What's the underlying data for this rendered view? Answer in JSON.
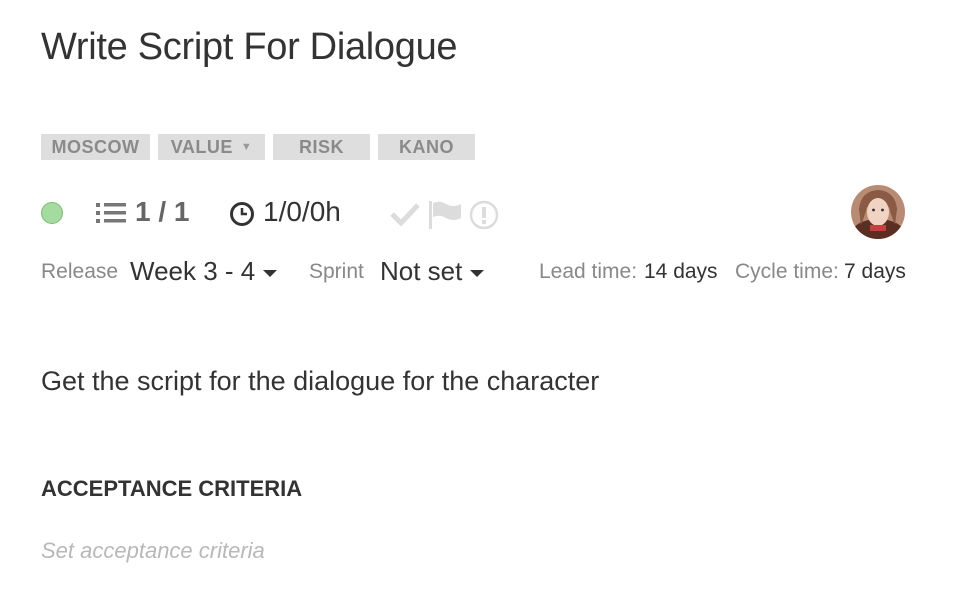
{
  "story": {
    "title": "Write Script For Dialogue",
    "description": "Get the script for the dialogue for the character"
  },
  "tags": [
    {
      "label": "MOSCOW"
    },
    {
      "label": "VALUE",
      "has_dropdown": true
    },
    {
      "label": "RISK"
    },
    {
      "label": "KANO"
    }
  ],
  "status": {
    "dot_color": "#a4dca0",
    "tasks": "1 / 1",
    "time": "1/0/0h",
    "icons": [
      "check-icon",
      "flag-icon",
      "alert-icon"
    ]
  },
  "meta": {
    "release_label": "Release",
    "release_value": "Week 3 - 4",
    "sprint_label": "Sprint",
    "sprint_value": "Not set",
    "lead_time_label": "Lead time:",
    "lead_time_value": "14 days",
    "cycle_time_label": "Cycle time:",
    "cycle_time_value": "7 days"
  },
  "acceptance": {
    "heading": "ACCEPTANCE CRITERIA",
    "placeholder": "Set acceptance criteria"
  }
}
